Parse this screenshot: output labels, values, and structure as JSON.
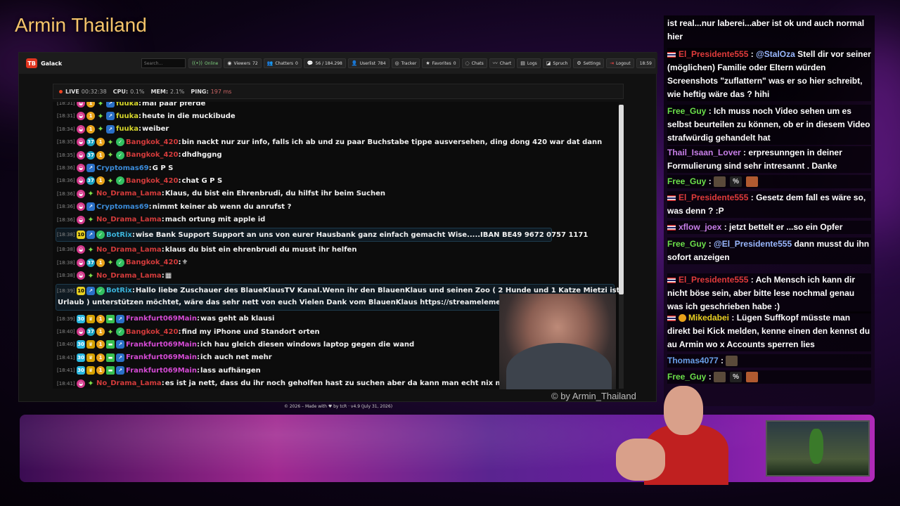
{
  "overlay": {
    "channel_title": "Armin Thailand",
    "watermark": "© by Armin_Thailand"
  },
  "app": {
    "logo": "TB",
    "name": "Galack",
    "search_placeholder": "Search...",
    "toolbar": [
      {
        "icon": "signal-icon",
        "label": "Online"
      },
      {
        "icon": "eye-icon",
        "label": "Viewers",
        "value": "72"
      },
      {
        "icon": "users-icon",
        "label": "Chatters",
        "value": "0"
      },
      {
        "icon": "chat-icon",
        "label": "56 / 184.298"
      },
      {
        "icon": "user-icon",
        "label": "Userlist",
        "value": "784"
      },
      {
        "icon": "tracker-icon",
        "label": "Tracker"
      },
      {
        "icon": "star-icon",
        "label": "Favorites",
        "value": "0"
      },
      {
        "icon": "chats-icon",
        "label": "Chats"
      },
      {
        "icon": "chart-icon",
        "label": "Chart"
      },
      {
        "icon": "logs-icon",
        "label": "Logs"
      },
      {
        "icon": "spruch-icon",
        "label": "Spruch"
      },
      {
        "icon": "gear-icon",
        "label": "Settings"
      },
      {
        "icon": "logout-icon",
        "label": "Logout"
      },
      {
        "icon": "clock-icon",
        "label": "18:59"
      }
    ],
    "status": {
      "live_label": "LIVE",
      "live_time": "00:32:38",
      "cpu_label": "CPU:",
      "cpu": "0.1%",
      "mem_label": "MEM:",
      "mem": "2.1%",
      "ping_label": "PING:",
      "ping": "197 ms"
    },
    "footer": "© 2026 – Made with ♥ by tcR · v4.9 (July 31, 2026)"
  },
  "chatlog": [
    {
      "ts": "[18:31]",
      "badges": [
        "pink",
        "orange",
        "star",
        "blue"
      ],
      "user": "fuuka",
      "color": "yel",
      "msg": "mal paar pferde"
    },
    {
      "ts": "[18:31]",
      "badges": [
        "pink",
        "orange",
        "star",
        "blue"
      ],
      "user": "fuuka",
      "color": "yel",
      "msg": "heute in die muckibude"
    },
    {
      "ts": "[18:34]",
      "badges": [
        "pink",
        "orange",
        "star",
        "blue"
      ],
      "user": "fuuka",
      "color": "yel",
      "msg": "weiber"
    },
    {
      "ts": "[18:35]",
      "badges": [
        "pink",
        "teal",
        "orange",
        "star",
        "green"
      ],
      "user": "Bangkok_420",
      "color": "red",
      "msg": "bin nackt nur zur info, falls ich ab und zu paar Buchstabe tippe ausversehen, ding dong 420 war dat dann"
    },
    {
      "ts": "[18:35]",
      "badges": [
        "pink",
        "teal",
        "orange",
        "star",
        "green"
      ],
      "user": "Bangkok_420",
      "color": "red",
      "msg": "dhdhggng"
    },
    {
      "ts": "[18:36]",
      "badges": [
        "pink",
        "blue"
      ],
      "user": "Cryptomas69",
      "color": "blue",
      "msg": "G P S"
    },
    {
      "ts": "[18:36]",
      "badges": [
        "pink",
        "teal",
        "orange",
        "star",
        "green"
      ],
      "user": "Bangkok_420",
      "color": "red",
      "msg": "chat G P S"
    },
    {
      "ts": "[18:36]",
      "badges": [
        "pink",
        "star"
      ],
      "user": "No_Drama_Lama",
      "color": "red",
      "msg": "Klaus, du bist ein Ehrenbrudi, du hilfst ihr beim Suchen"
    },
    {
      "ts": "[18:36]",
      "badges": [
        "pink",
        "blue"
      ],
      "user": "Cryptomas69",
      "color": "blue",
      "msg": "nimmt keiner ab wenn du anrufst ?"
    },
    {
      "ts": "[18:36]",
      "badges": [
        "pink",
        "star"
      ],
      "user": "No_Drama_Lama",
      "color": "red",
      "msg": "mach ortung mit apple id"
    },
    {
      "ts": "[18:38]",
      "badges": [
        "yel",
        "blue",
        "green"
      ],
      "user": "BotRix",
      "color": "cyan",
      "msg": "wise Bank Support Support an uns von eurer Hausbank ganz einfach gemacht Wise.....IBAN BE49 9672 0757 1171",
      "yelnum": "10",
      "highlight": true
    },
    {
      "ts": "[18:38]",
      "badges": [
        "pink",
        "star"
      ],
      "user": "No_Drama_Lama",
      "color": "red",
      "msg": "klaus du bist ein ehrenbrudi du musst ihr helfen"
    },
    {
      "ts": "[18:38]",
      "badges": [
        "pink",
        "teal",
        "orange",
        "star",
        "green"
      ],
      "user": "Bangkok_420",
      "color": "red",
      "msg": "⚜"
    },
    {
      "ts": "[18:38]",
      "badges": [
        "pink",
        "star"
      ],
      "user": "No_Drama_Lama",
      "color": "red",
      "msg": "▦"
    },
    {
      "ts": "[18:39]",
      "badges": [
        "yel",
        "blue",
        "green"
      ],
      "user": "BotRix",
      "color": "cyan",
      "msg": "Hallo liebe Zuschauer des BlaueKlausTV Kanal.Wenn ihr den BlauenKlaus und seinen Zoo ( 2 Hunde und 1 Katze Mietzi ist auf",
      "msg2": "Urlaub ) unterstützen möchtet, wäre das sehr nett von euch Vielen Dank vom BlauenKlaus https://streamelements.com/blaueklaustv/tip",
      "yelnum": "10",
      "highlight": true,
      "double": true
    },
    {
      "ts": "[18:39]",
      "badges": [
        "cyan",
        "gold",
        "orange",
        "sub",
        "blue"
      ],
      "user": "Frankfurt069Main",
      "color": "pink",
      "msg": "was geht ab klausi",
      "cyannum": "30"
    },
    {
      "ts": "[18:40]",
      "badges": [
        "pink",
        "teal",
        "orange",
        "star",
        "green"
      ],
      "user": "Bangkok_420",
      "color": "red",
      "msg": "find my iPhone und Standort orten"
    },
    {
      "ts": "[18:40]",
      "badges": [
        "cyan",
        "gold",
        "orange",
        "sub",
        "blue"
      ],
      "user": "Frankfurt069Main",
      "color": "pink",
      "msg": "ich hau gleich diesen windows laptop gegen die wand",
      "cyannum": "30"
    },
    {
      "ts": "[18:41]",
      "badges": [
        "cyan",
        "gold",
        "orange",
        "sub",
        "blue"
      ],
      "user": "Frankfurt069Main",
      "color": "pink",
      "msg": "ich auch net mehr",
      "cyannum": "30"
    },
    {
      "ts": "[18:41]",
      "badges": [
        "cyan",
        "gold",
        "orange",
        "sub",
        "blue"
      ],
      "user": "Frankfurt069Main",
      "color": "pink",
      "msg": "lass aufhängen",
      "cyannum": "30"
    },
    {
      "ts": "[18:41]",
      "badges": [
        "pink",
        "star"
      ],
      "user": "No_Drama_Lama",
      "color": "red",
      "msg": "es ist ja nett, dass du ihr noch geholfen hast zu suchen aber da kann man echt nix mehr machen"
    }
  ],
  "rightchat": {
    "first_text": "ist real...nur laberei...aber ist ok und auch normal hier",
    "messages": [
      {
        "user": "El_Presidente555",
        "flag": true,
        "mention": "@StalOza",
        "text": "Stell dir vor seiner (möglichen) Familie oder Eltern würden Screenshots \"zuflattern\" was er so hier schreibt, wie heftig wäre das ? hihi"
      },
      {
        "user": "Free_Guy",
        "text": "Ich muss noch Video sehen um es selbst beurteilen zu können, ob er in diesem Video strafwürdig gehandelt hat"
      },
      {
        "user": "Thail_Isaan_Lover",
        "text": "erpresunngen in deiner Formulierung sind sehr intresannt . Danke"
      },
      {
        "user": "Free_Guy",
        "emotes": true
      },
      {
        "user": "El_Presidente555",
        "flag": true,
        "text": "Gesetz dem fall es wäre so, was denn ? :P"
      },
      {
        "user": "xflow_joex",
        "flag": true,
        "text": "jetzt bettelt er ...so ein Opfer"
      },
      {
        "user": "Free_Guy",
        "mention": "@El_Presidente555",
        "text": "dann musst du ihn sofort anzeigen"
      },
      {
        "user": "El_Presidente555",
        "flag": true,
        "text": "Ach Mensch ich kann dir nicht böse sein, aber bitte lese nochmal genau was ich geschrieben habe :)"
      },
      {
        "user": "Mikedabei",
        "flag": true,
        "coin": true,
        "text": "Lügen Suffkopf müsste man direkt bei Kick melden, kenne einen den kennst du au Armin wo x Accounts sperren lies"
      },
      {
        "user": "Thomas4077",
        "emote_single": true
      },
      {
        "user": "Free_Guy",
        "emotes": true
      }
    ]
  }
}
